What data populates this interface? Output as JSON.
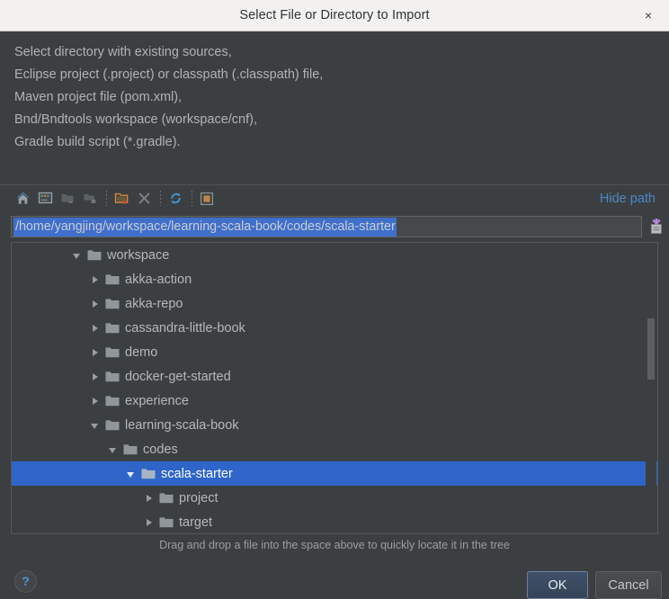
{
  "window": {
    "title": "Select File or Directory to Import",
    "close_label": "×"
  },
  "description": {
    "lines": [
      "Select directory with existing sources,",
      "Eclipse project (.project) or classpath (.classpath) file,",
      "Maven project file (pom.xml),",
      "Bnd/Bndtools workspace (workspace/cnf),",
      "Gradle build script (*.gradle)."
    ]
  },
  "toolbar": {
    "buttons": [
      {
        "name": "home-icon",
        "tooltip": "Home"
      },
      {
        "name": "desktop-icon",
        "tooltip": "Desktop"
      },
      {
        "name": "folder-up-icon",
        "tooltip": "Up"
      },
      {
        "name": "project-folder-icon",
        "tooltip": "Project Directory"
      },
      {
        "name": "new-folder-icon",
        "tooltip": "New Folder"
      },
      {
        "name": "delete-icon",
        "tooltip": "Delete"
      },
      {
        "name": "refresh-icon",
        "tooltip": "Refresh"
      },
      {
        "name": "show-hidden-files-icon",
        "tooltip": "Show Hidden Files"
      }
    ],
    "hide_path_label": "Hide path"
  },
  "path_field": {
    "value": "/home/yangjing/workspace/learning-scala-book/codes/scala-starter",
    "placeholder": "",
    "selected": true,
    "paste_icon": "paste-icon"
  },
  "tree": {
    "rows": [
      {
        "label": "workspace",
        "indent": 1,
        "state": "expanded",
        "selected": false
      },
      {
        "label": "akka-action",
        "indent": 2,
        "state": "collapsed",
        "selected": false
      },
      {
        "label": "akka-repo",
        "indent": 2,
        "state": "collapsed",
        "selected": false
      },
      {
        "label": "cassandra-little-book",
        "indent": 2,
        "state": "collapsed",
        "selected": false
      },
      {
        "label": "demo",
        "indent": 2,
        "state": "collapsed",
        "selected": false
      },
      {
        "label": "docker-get-started",
        "indent": 2,
        "state": "collapsed",
        "selected": false
      },
      {
        "label": "experience",
        "indent": 2,
        "state": "collapsed",
        "selected": false
      },
      {
        "label": "learning-scala-book",
        "indent": 2,
        "state": "expanded",
        "selected": false
      },
      {
        "label": "codes",
        "indent": 3,
        "state": "expanded",
        "selected": false
      },
      {
        "label": "scala-starter",
        "indent": 4,
        "state": "expanded",
        "selected": true
      },
      {
        "label": "project",
        "indent": 5,
        "state": "collapsed",
        "selected": false
      },
      {
        "label": "target",
        "indent": 5,
        "state": "collapsed",
        "selected": false
      }
    ]
  },
  "hint": {
    "text": "Drag and drop a file into the space above to quickly locate it in the tree"
  },
  "footer": {
    "help_label": "?",
    "ok_label": "OK",
    "cancel_label": "Cancel"
  },
  "colors": {
    "background": "#3c3f41",
    "titlebar": "#f2f1f0",
    "selection": "#2f65c8",
    "path_selection": "#3f6fcb",
    "link": "#4a88c7",
    "text": "#b5b8ba"
  }
}
